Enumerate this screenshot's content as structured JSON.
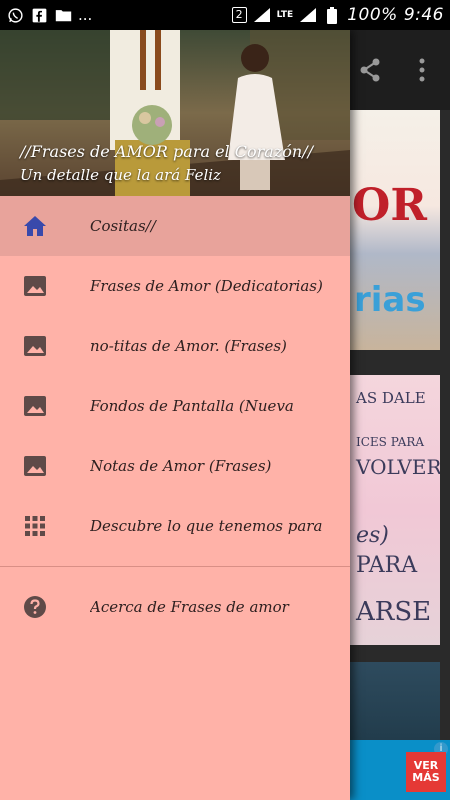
{
  "status_bar": {
    "network_badge": "2",
    "lte_label": "LTE",
    "battery_percent": "100%",
    "time": "9:46",
    "overflow": "..."
  },
  "drawer": {
    "header": {
      "title": "//Frases de AMOR para el Corazón//",
      "subtitle": "Un detalle que la ará Feliz"
    },
    "items": [
      {
        "label": "Cositas//",
        "icon": "home-icon",
        "active": true
      },
      {
        "label": "Frases de Amor (Dedicatorias)",
        "icon": "image-icon",
        "active": false
      },
      {
        "label": "no-titas de Amor. (Frases)",
        "icon": "image-icon",
        "active": false
      },
      {
        "label": "Fondos de Pantalla (Nueva",
        "icon": "image-icon",
        "active": false
      },
      {
        "label": "Notas de Amor (Frases)",
        "icon": "image-icon",
        "active": false
      },
      {
        "label": "Descubre lo que tenemos para",
        "icon": "grid-icon",
        "active": false
      }
    ],
    "footer_items": [
      {
        "label": "Acerca de Frases de amor",
        "icon": "help-icon"
      }
    ]
  },
  "background": {
    "card1_word": "OR",
    "card1_blue": "rias",
    "card2_lines": [
      "AS DALE",
      "ICES PARA",
      "VOLVER",
      "es)",
      "PARA",
      "ARSE"
    ],
    "ad_button": "VER MÁS",
    "ad_info": "i"
  },
  "colors": {
    "drawer_bg": "#ffb2a8",
    "active_item_bg": "#e8a39b",
    "home_icon": "#3949ab",
    "icon_gray": "#5f4a48"
  }
}
